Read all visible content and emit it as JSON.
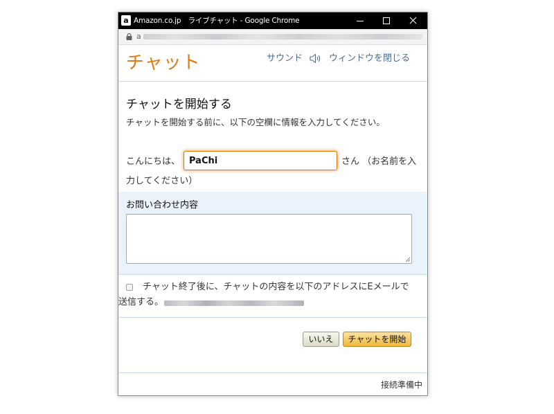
{
  "window": {
    "icon_letter": "a",
    "title": "Amazon.co.jp　ライブチャット - Google Chrome"
  },
  "addressbar": {
    "url_visible": "a"
  },
  "header": {
    "chat_title": "チャット",
    "sound_label": "サウンド",
    "close_label": "ウィンドウを閉じる"
  },
  "intro": {
    "title": "チャットを開始する",
    "description": "チャットを開始する前に、以下の空欄に情報を入力してください。"
  },
  "name_row": {
    "prefix": "こんにちは、",
    "value": "PaChi",
    "suffix": "さん （お名前を入",
    "suffix_wrap": "力してください）"
  },
  "inquiry": {
    "label": "お問い合わせ内容",
    "value": ""
  },
  "email": {
    "checked": false,
    "line1": "チャット終了後に、チャットの内容を以下のアドレスにEメールで",
    "line2": "送信する。"
  },
  "buttons": {
    "no_label": "いいえ",
    "start_label": "チャットを開始"
  },
  "footer": {
    "status": "接続準備中"
  },
  "colors": {
    "title_orange": "#e47911",
    "link_blue": "#4a6b95",
    "section_bg": "#eaf2fb",
    "start_button": "#f0b73a"
  }
}
